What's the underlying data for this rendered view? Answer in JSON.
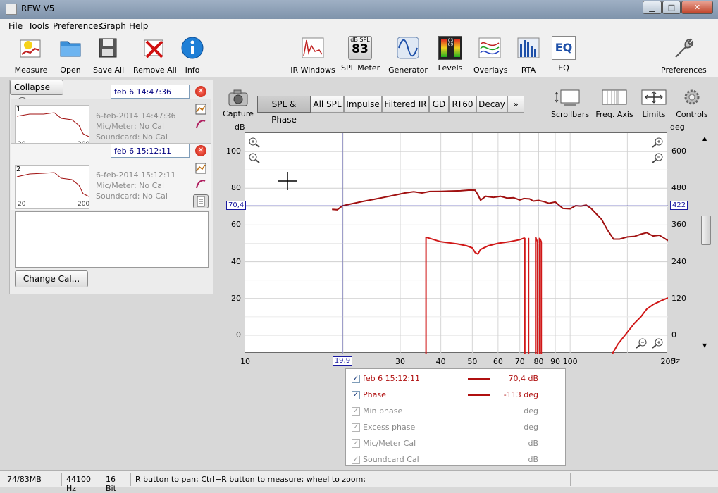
{
  "window": {
    "title": "REW V5",
    "minimize": "▁",
    "maximize": "□",
    "close": "✕"
  },
  "menu": [
    "File",
    "Tools",
    "Preferences",
    "Graph",
    "Help"
  ],
  "toolbar_left": [
    {
      "label": "Measure",
      "icon": "measure-icon"
    },
    {
      "label": "Open",
      "icon": "folder-open-icon"
    },
    {
      "label": "Save All",
      "icon": "save-all-icon"
    },
    {
      "label": "Remove All",
      "icon": "remove-all-icon"
    },
    {
      "label": "Info",
      "icon": "info-icon"
    }
  ],
  "toolbar_center": [
    {
      "label": "IR Windows",
      "icon": "ir-windows-icon"
    },
    {
      "label": "SPL Meter",
      "icon": "spl-meter-icon",
      "badge_top": "dB SPL",
      "badge_value": "83"
    },
    {
      "label": "Generator",
      "icon": "generator-icon"
    },
    {
      "label": "Levels",
      "icon": "levels-icon",
      "badge_value": "0369"
    },
    {
      "label": "Overlays",
      "icon": "overlays-icon"
    },
    {
      "label": "RTA",
      "icon": "rta-icon"
    },
    {
      "label": "EQ",
      "icon": "eq-icon",
      "badge_value": "EQ"
    }
  ],
  "toolbar_right": {
    "label": "Preferences",
    "icon": "wrench-icon"
  },
  "leftpanel": {
    "collapse_label": "Collapse",
    "collapse_glyph": "«",
    "measurements": [
      {
        "index": "1",
        "name": "feb 6 14:47:36",
        "date": "6-feb-2014 14:47:36",
        "mic": "Mic/Meter: No Cal",
        "soundcard": "Soundcard: No Cal",
        "thumb_x_min": "20",
        "thumb_x_max": "200"
      },
      {
        "index": "2",
        "name": "feb 6 15:12:11",
        "date": "6-feb-2014 15:12:11",
        "mic": "Mic/Meter: No Cal",
        "soundcard": "Soundcard: No Cal",
        "thumb_x_min": "20",
        "thumb_x_max": "200"
      }
    ],
    "change_cal_label": "Change Cal..."
  },
  "capture": {
    "label": "Capture"
  },
  "tabs": [
    {
      "label": "SPL & Phase",
      "active": true
    },
    {
      "label": "All SPL",
      "active": false
    },
    {
      "label": "Impulse",
      "active": false
    },
    {
      "label": "Filtered IR",
      "active": false
    },
    {
      "label": "GD",
      "active": false
    },
    {
      "label": "RT60",
      "active": false
    },
    {
      "label": "Decay",
      "active": false
    },
    {
      "label": "»",
      "active": false
    }
  ],
  "graph_controls": [
    {
      "label": "Scrollbars",
      "icon": "scrollbars-icon"
    },
    {
      "label": "Freq. Axis",
      "icon": "freq-axis-icon"
    },
    {
      "label": "Limits",
      "icon": "limits-icon"
    },
    {
      "label": "Controls",
      "icon": "gear-icon"
    }
  ],
  "chart_data": {
    "type": "line",
    "xlabel": "Hz",
    "ylabel": "dB",
    "y2label": "deg",
    "xscale": "log",
    "xlim": [
      10,
      200
    ],
    "ylim": [
      -10,
      110
    ],
    "y2lim": [
      -60,
      660
    ],
    "x_ticks": [
      "10",
      "30",
      "40",
      "50",
      "60",
      "70",
      "80",
      "90",
      "100",
      "200"
    ],
    "y_ticks": [
      "100",
      "80",
      "60",
      "40",
      "20",
      "0"
    ],
    "y2_ticks": [
      "600",
      "480",
      "360",
      "240",
      "120",
      "0"
    ],
    "cursor": {
      "x_label": "19,9",
      "y_label": "70,4",
      "y2_label": "422",
      "x": 19.9,
      "y": 70.4
    },
    "series": [
      {
        "name": "feb 6 15:12:11",
        "color": "#a01010",
        "axis": "left",
        "x": [
          18.5,
          19.2,
          19.9,
          21,
          23,
          25,
          27,
          29,
          31,
          33,
          35,
          37,
          40,
          43,
          46,
          49,
          51,
          52,
          53,
          55,
          58,
          61,
          64,
          67,
          70,
          72,
          75,
          77,
          80,
          83,
          86,
          90,
          95,
          100,
          104,
          108,
          112,
          116,
          120,
          125,
          130,
          136,
          142,
          150,
          158,
          165,
          172,
          180,
          188,
          194,
          200
        ],
        "y": [
          68.5,
          68.3,
          70.4,
          71.3,
          72.8,
          74,
          75.2,
          76.3,
          77.4,
          78.1,
          77.4,
          78.2,
          78.3,
          78.5,
          78.6,
          79,
          78.9,
          76.5,
          73.5,
          75.6,
          75,
          75.6,
          74.6,
          74.8,
          73.6,
          74.4,
          74.2,
          73,
          73.4,
          72.7,
          71.8,
          72.5,
          69,
          68.8,
          70.5,
          70.3,
          70.8,
          69,
          66.3,
          63,
          57.5,
          52.3,
          52.3,
          53.5,
          53.8,
          55,
          55.8,
          54,
          54.4,
          53,
          51.5
        ]
      },
      {
        "name": "Phase",
        "color": "#d01818",
        "axis": "right",
        "segments": [
          {
            "x": [
              36,
              36
            ],
            "y": [
              -60,
              320
            ]
          },
          {
            "x": [
              36,
              40,
              45,
              48,
              50,
              51,
              52,
              53,
              56,
              60,
              65,
              70,
              72.5
            ],
            "y": [
              320,
              305,
              298,
              292,
              285,
              270,
              265,
              280,
              292,
              300,
              305,
              312,
              318
            ]
          },
          {
            "x": [
              72.5,
              72.5
            ],
            "y": [
              318,
              -60
            ]
          },
          {
            "x": [
              74.5,
              74.5
            ],
            "y": [
              -60,
              318
            ]
          },
          {
            "x": [
              78.3,
              78.3
            ],
            "y": [
              -60,
              320
            ]
          },
          {
            "x": [
              78.3,
              79.3
            ],
            "y": [
              320,
              305
            ]
          },
          {
            "x": [
              79.3,
              79.3
            ],
            "y": [
              305,
              -60
            ]
          },
          {
            "x": [
              80.5,
              80.5
            ],
            "y": [
              -60,
              318
            ]
          },
          {
            "x": [
              80.5,
              81.5
            ],
            "y": [
              318,
              305
            ]
          },
          {
            "x": [
              81.5,
              81.5
            ],
            "y": [
              305,
              -60
            ]
          },
          {
            "x": [
              135,
              140,
              150,
              158,
              165,
              172,
              180,
              190,
              200
            ],
            "y": [
              -60,
              -30,
              10,
              40,
              60,
              85,
              100,
              112,
              122
            ]
          }
        ]
      }
    ]
  },
  "legend": [
    {
      "label": "feb 6 15:12:11",
      "value": "70,4 dB",
      "checked": true,
      "active": true,
      "show_line": true
    },
    {
      "label": "Phase",
      "value": "-113 deg",
      "checked": true,
      "active": true,
      "show_line": true
    },
    {
      "label": "Min phase",
      "value": "deg",
      "checked": true,
      "active": false,
      "show_line": false
    },
    {
      "label": "Excess phase",
      "value": "deg",
      "checked": true,
      "active": false,
      "show_line": false
    },
    {
      "label": "Mic/Meter Cal",
      "value": "dB",
      "checked": true,
      "active": false,
      "show_line": false
    },
    {
      "label": "Soundcard Cal",
      "value": "dB",
      "checked": true,
      "active": false,
      "show_line": false
    }
  ],
  "status": {
    "memory": "74/83MB",
    "sample_rate": "44100 Hz",
    "bit_depth": "16 Bit",
    "hint": "R button to pan; Ctrl+R button to measure; wheel to zoom;"
  },
  "colors": {
    "spl_line": "#a01010",
    "phase_line": "#d01818",
    "cursor": "#1a1aa0"
  }
}
